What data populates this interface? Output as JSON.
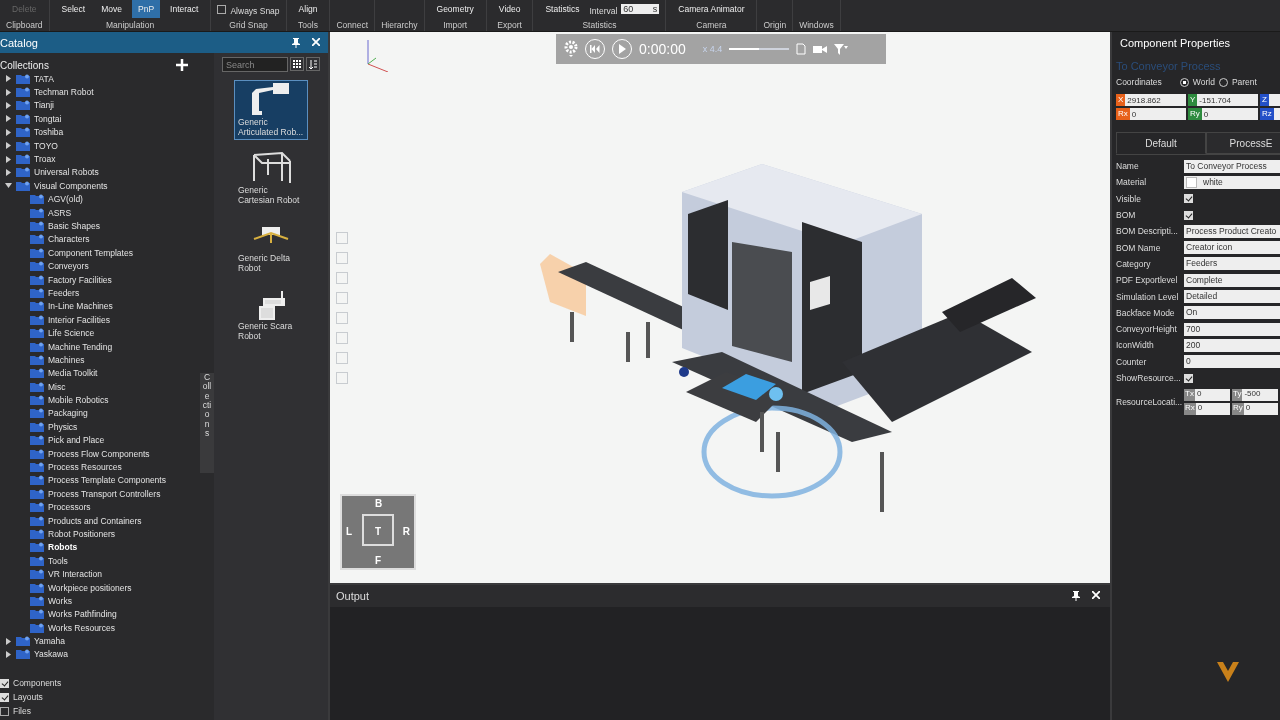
{
  "ribbon": {
    "groups": [
      {
        "title": "Clipboard",
        "buttons": [
          {
            "label": "Delete",
            "disabled": true,
            "selected": false
          }
        ]
      },
      {
        "title": "Manipulation",
        "buttons": [
          {
            "label": "Select",
            "disabled": false,
            "selected": false
          },
          {
            "label": "Move",
            "disabled": false,
            "selected": false
          },
          {
            "label": "PnP",
            "disabled": false,
            "selected": true
          },
          {
            "label": "Interact",
            "disabled": false,
            "selected": false
          }
        ]
      },
      {
        "title": "Grid Snap",
        "checkbox": {
          "label": "Always Snap",
          "checked": false
        }
      },
      {
        "title": "Tools",
        "buttons": [
          {
            "label": "Align",
            "disabled": false,
            "selected": false
          }
        ]
      },
      {
        "title": "Connect"
      },
      {
        "title": "Hierarchy"
      },
      {
        "title": "Import",
        "buttons": [
          {
            "label": "Geometry",
            "disabled": false,
            "selected": false
          }
        ]
      },
      {
        "title": "Export",
        "buttons": [
          {
            "label": "Video",
            "disabled": false,
            "selected": false
          }
        ]
      },
      {
        "title": "Statistics",
        "buttons": [
          {
            "label": "Statistics",
            "disabled": false,
            "selected": false
          }
        ],
        "interval": {
          "label": "Interval",
          "value": "60",
          "unit": "s"
        }
      },
      {
        "title": "Camera",
        "buttons": [
          {
            "label": "Camera Animator",
            "disabled": false,
            "selected": false
          }
        ]
      },
      {
        "title": "Origin"
      },
      {
        "title": "Windows"
      }
    ]
  },
  "catalog": {
    "title": "Catalog",
    "collections_label": "Collections",
    "search": {
      "placeholder": "Search"
    },
    "side_tab": "Collections",
    "tree": [
      {
        "name": "TATA",
        "expanded": false,
        "selected": false
      },
      {
        "name": "Techman Robot",
        "expanded": false,
        "selected": false
      },
      {
        "name": "Tianji",
        "expanded": false,
        "selected": false
      },
      {
        "name": "Tongtai",
        "expanded": false,
        "selected": false
      },
      {
        "name": "Toshiba",
        "expanded": false,
        "selected": false
      },
      {
        "name": "TOYO",
        "expanded": false,
        "selected": false
      },
      {
        "name": "Troax",
        "expanded": false,
        "selected": false
      },
      {
        "name": "Universal Robots",
        "expanded": false,
        "selected": false
      },
      {
        "name": "Visual Components",
        "expanded": true,
        "selected": false,
        "children": [
          {
            "name": "AGV(old)",
            "selected": false
          },
          {
            "name": "ASRS",
            "selected": false
          },
          {
            "name": "Basic Shapes",
            "selected": false
          },
          {
            "name": "Characters",
            "selected": false
          },
          {
            "name": "Component Templates",
            "selected": false
          },
          {
            "name": "Conveyors",
            "selected": false
          },
          {
            "name": "Factory Facilities",
            "selected": false
          },
          {
            "name": "Feeders",
            "selected": false
          },
          {
            "name": "In-Line Machines",
            "selected": false
          },
          {
            "name": "Interior Facilities",
            "selected": false
          },
          {
            "name": "Life Science",
            "selected": false
          },
          {
            "name": "Machine Tending",
            "selected": false
          },
          {
            "name": "Machines",
            "selected": false
          },
          {
            "name": "Media Toolkit",
            "selected": false
          },
          {
            "name": "Misc",
            "selected": false
          },
          {
            "name": "Mobile Robotics",
            "selected": false
          },
          {
            "name": "Packaging",
            "selected": false
          },
          {
            "name": "Physics",
            "selected": false
          },
          {
            "name": "Pick and Place",
            "selected": false
          },
          {
            "name": "Process Flow Components",
            "selected": false
          },
          {
            "name": "Process Resources",
            "selected": false
          },
          {
            "name": "Process Template Components",
            "selected": false
          },
          {
            "name": "Process Transport Controllers",
            "selected": false
          },
          {
            "name": "Processors",
            "selected": false
          },
          {
            "name": "Products and Containers",
            "selected": false
          },
          {
            "name": "Robot Positioners",
            "selected": false
          },
          {
            "name": "Robots",
            "selected": true
          },
          {
            "name": "Tools",
            "selected": false
          },
          {
            "name": "VR Interaction",
            "selected": false
          },
          {
            "name": "Workpiece positioners",
            "selected": false
          },
          {
            "name": "Works",
            "selected": false
          },
          {
            "name": "Works Pathfinding",
            "selected": false
          },
          {
            "name": "Works Resources",
            "selected": false
          }
        ]
      },
      {
        "name": "Yamaha",
        "expanded": false,
        "selected": false
      },
      {
        "name": "Yaskawa",
        "expanded": false,
        "selected": false
      }
    ],
    "filters": [
      {
        "label": "Components",
        "checked": true
      },
      {
        "label": "Layouts",
        "checked": true
      },
      {
        "label": "Files",
        "checked": false
      }
    ],
    "items": [
      {
        "label": "Generic Articulated Rob...",
        "kind": "articulated",
        "selected": true
      },
      {
        "label": "Generic Cartesian Robot",
        "kind": "cartesian",
        "selected": false
      },
      {
        "label": "Generic Delta Robot",
        "kind": "delta",
        "selected": false
      },
      {
        "label": "Generic Scara Robot",
        "kind": "scara",
        "selected": false
      }
    ]
  },
  "viewport": {
    "time": "0:00:00",
    "speed": "x 4.4",
    "speed_slider": {
      "level": 0.5
    },
    "nav_cube": {
      "top": "B",
      "left": "L",
      "center": "T",
      "right": "R",
      "bottom": "F"
    }
  },
  "output": {
    "title": "Output"
  },
  "properties": {
    "title": "Component Properties",
    "component": "To Conveyor Process",
    "coordinates": {
      "label": "Coordinates",
      "options": [
        {
          "label": "World",
          "selected": true
        },
        {
          "label": "Parent",
          "selected": false
        }
      ]
    },
    "fields": [
      {
        "axis": "X",
        "value": "2918.862",
        "color": "#e8611a"
      },
      {
        "axis": "Y",
        "value": "-151.704",
        "color": "#2e8b3e"
      },
      {
        "axis": "Z",
        "color": "#2350c8"
      },
      {
        "axis": "Rx",
        "value": "0",
        "color": "#e8611a"
      },
      {
        "axis": "Ry",
        "value": "0",
        "color": "#2e8b3e"
      },
      {
        "axis": "Rz",
        "color": "#2350c8"
      }
    ],
    "tabs": [
      {
        "label": "Default",
        "selected": true
      },
      {
        "label": "ProcessE",
        "selected": false
      }
    ],
    "rows": [
      {
        "kind": "text",
        "label": "Name",
        "value": "To Conveyor Process"
      },
      {
        "kind": "material",
        "label": "Material",
        "value": "white"
      },
      {
        "kind": "check",
        "label": "Visible",
        "checked": true
      },
      {
        "kind": "check",
        "label": "BOM",
        "checked": true
      },
      {
        "kind": "text",
        "label": "BOM Descripti...",
        "value": "Process Product Creato"
      },
      {
        "kind": "text",
        "label": "BOM Name",
        "value": "Creator icon"
      },
      {
        "kind": "text",
        "label": "Category",
        "value": "Feeders"
      },
      {
        "kind": "text",
        "label": "PDF Exportlevel",
        "value": "Complete"
      },
      {
        "kind": "text",
        "label": "Simulation Level",
        "value": "Detailed"
      },
      {
        "kind": "text",
        "label": "Backface Mode",
        "value": "On"
      },
      {
        "kind": "text",
        "label": "ConveyorHeight",
        "value": "700"
      },
      {
        "kind": "text",
        "label": "IconWidth",
        "value": "200"
      },
      {
        "kind": "text",
        "label": "Counter",
        "value": "0"
      },
      {
        "kind": "check",
        "label": "ShowResource...",
        "checked": true
      },
      {
        "kind": "location",
        "label": "ResourceLocati...",
        "cells": [
          {
            "axis": "Tx",
            "value": "0"
          },
          {
            "axis": "Ty",
            "value": "-500"
          },
          {
            "axis": "Rx",
            "value": "0"
          },
          {
            "axis": "Ry",
            "value": "0"
          }
        ]
      }
    ]
  }
}
